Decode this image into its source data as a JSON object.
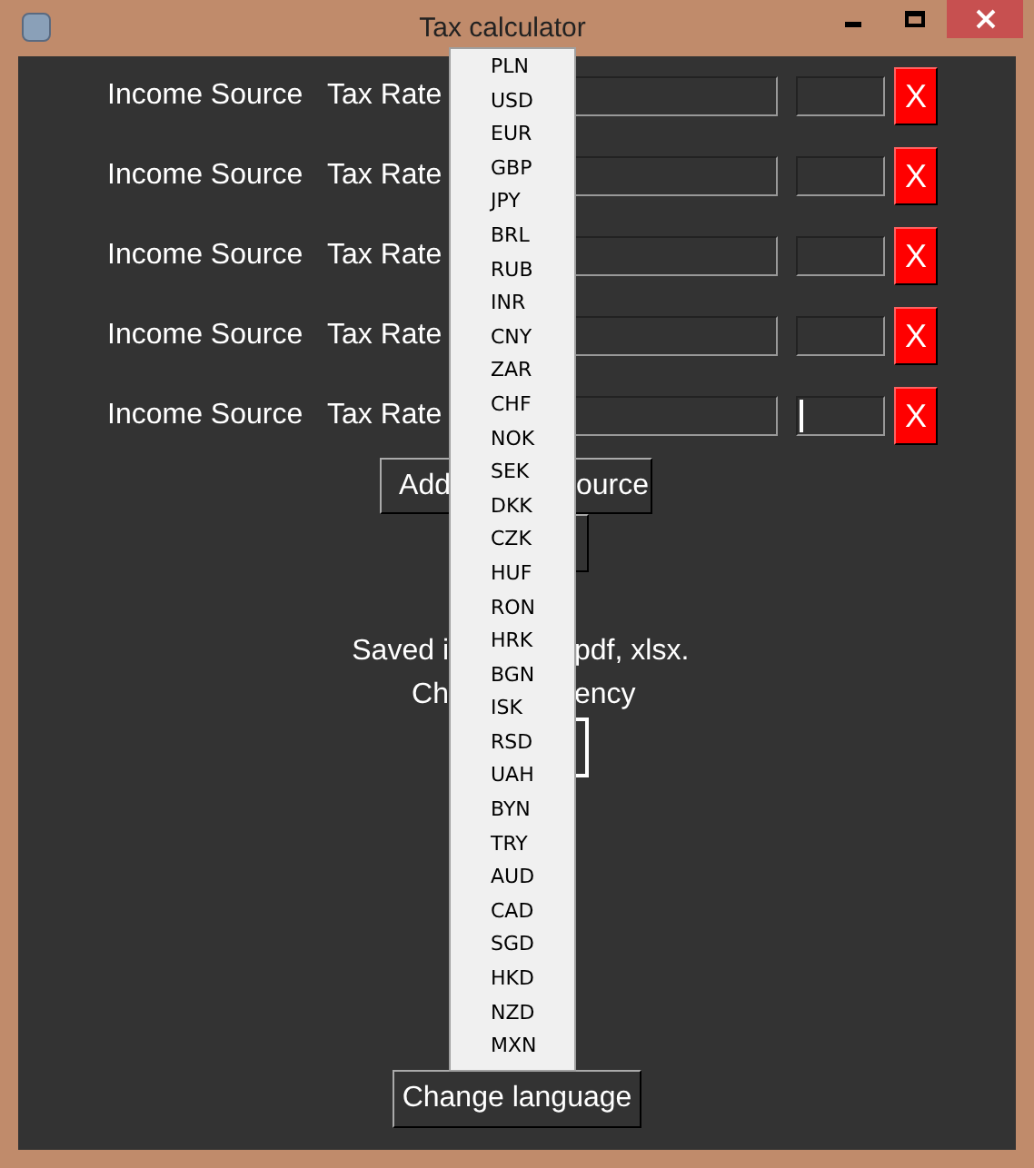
{
  "window": {
    "title": "Tax calculator"
  },
  "rows": [
    {
      "source_label": "Income Source",
      "rate_label": "Tax Rate",
      "delete_button": "X",
      "rate_focused": false
    },
    {
      "source_label": "Income Source",
      "rate_label": "Tax Rate",
      "delete_button": "X",
      "rate_focused": false
    },
    {
      "source_label": "Income Source",
      "rate_label": "Tax Rate",
      "delete_button": "X",
      "rate_focused": false
    },
    {
      "source_label": "Income Source",
      "rate_label": "Tax Rate",
      "delete_button": "X",
      "rate_focused": false
    },
    {
      "source_label": "Income Source",
      "rate_label": "Tax Rate",
      "delete_button": "X",
      "rate_focused": true
    }
  ],
  "add_button": {
    "text_before": "Add",
    "text_after": "ource"
  },
  "saved_note": {
    "text_before": "Saved i",
    "text_after": "pdf, xlsx."
  },
  "currency_label": {
    "text_before": "Ch",
    "text_after": "ency"
  },
  "currency_list": [
    "PLN",
    "USD",
    "EUR",
    "GBP",
    "JPY",
    "BRL",
    "RUB",
    "INR",
    "CNY",
    "ZAR",
    "CHF",
    "NOK",
    "SEK",
    "DKK",
    "CZK",
    "HUF",
    "RON",
    "HRK",
    "BGN",
    "ISK",
    "RSD",
    "UAH",
    "BYN",
    "TRY",
    "AUD",
    "CAD",
    "SGD",
    "HKD",
    "NZD",
    "MXN"
  ],
  "language_button": "Change language"
}
